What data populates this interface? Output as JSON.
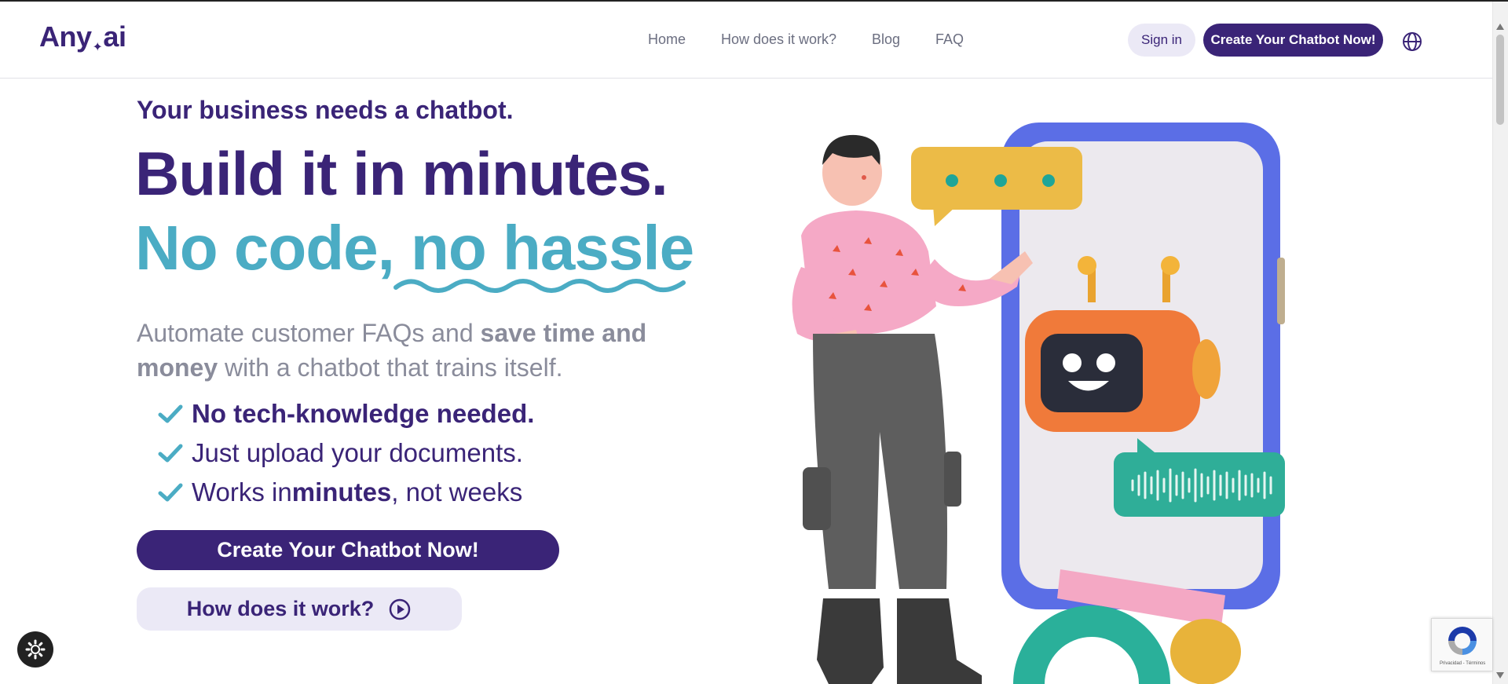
{
  "header": {
    "logo_text": "Any",
    "logo_suffix": "ai",
    "nav": [
      "Home",
      "How does it work?",
      "Blog",
      "FAQ"
    ],
    "sign_in": "Sign in",
    "create_button": "Create Your Chatbot Now!",
    "language_icon": "globe-icon"
  },
  "hero": {
    "eyebrow_plain": "Your business ",
    "eyebrow_bold": "needs a chatbot.",
    "headline": "Build it in minutes.",
    "headline2": "No code, no hassle",
    "desc_1": "Automate customer FAQs and ",
    "desc_bold_1": "save time and money",
    "desc_2": " with a chatbot that trains itself.",
    "checks": [
      {
        "bold": "No tech-knowledge needed.",
        "after": ""
      },
      {
        "plain": "Just upload your documents."
      },
      {
        "before": "Works in ",
        "bold": "minutes",
        "after": ", not weeks"
      }
    ],
    "cta_primary": "Create Your Chatbot Now!",
    "cta_secondary": "How does it work?"
  },
  "widgets": {
    "recaptcha_text": "Privacidad - Términos",
    "settings_icon": "gear-icon"
  },
  "colors": {
    "brand_purple": "#3a2477",
    "accent_teal": "#4bacc4",
    "muted_text": "#8a8c9b",
    "soft_lavender": "#ebe9f6"
  }
}
